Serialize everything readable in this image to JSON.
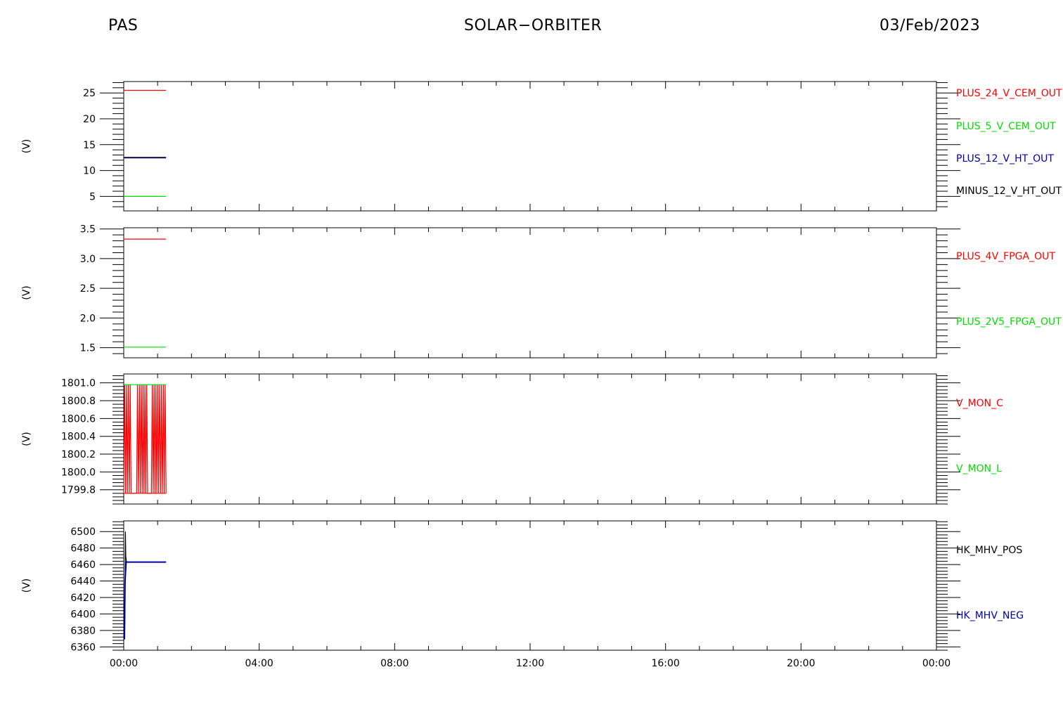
{
  "header": {
    "instrument": "PAS",
    "mission": "SOLAR−ORBITER",
    "date": "03/Feb/2023"
  },
  "time_axis": {
    "labels": [
      "00:00",
      "04:00",
      "08:00",
      "12:00",
      "16:00",
      "20:00",
      "00:00"
    ],
    "range_hours": [
      0,
      24
    ]
  },
  "chart_data": [
    {
      "type": "line",
      "ylabel": "(V)",
      "ylim": [
        2.2,
        27.2
      ],
      "yticks": [
        5,
        10,
        15,
        20,
        25
      ],
      "ytick_labels": [
        "5",
        "10",
        "15",
        "20",
        "25"
      ],
      "series": [
        {
          "name": "PLUS_24_V_CEM_OUT",
          "color": "#ff0000",
          "x": [
            0.0,
            1.25
          ],
          "y": [
            25.5,
            25.5
          ]
        },
        {
          "name": "PLUS_5_V_CEM_OUT",
          "color": "#00dd00",
          "x": [
            0.0,
            1.25
          ],
          "y": [
            5.0,
            5.0
          ]
        },
        {
          "name": "PLUS_12_V_HT_OUT",
          "color": "#0000aa",
          "x": [
            0.0,
            1.25
          ],
          "y": [
            12.5,
            12.5
          ]
        },
        {
          "name": "MINUS_12_V_HT_OUT",
          "color": "#000000",
          "x": [
            0.0,
            1.25
          ],
          "y": [
            12.5,
            12.5
          ]
        }
      ]
    },
    {
      "type": "line",
      "ylabel": "(V)",
      "ylim": [
        1.33,
        3.52
      ],
      "yticks": [
        1.5,
        2.0,
        2.5,
        3.0,
        3.5
      ],
      "ytick_labels": [
        "1.5",
        "2.0",
        "2.5",
        "3.0",
        "3.5"
      ],
      "series": [
        {
          "name": "PLUS_4V_FPGA_OUT",
          "color": "#ff0000",
          "x": [
            0.0,
            1.25
          ],
          "y": [
            3.33,
            3.33
          ]
        },
        {
          "name": "PLUS_2V5_FPGA_OUT",
          "color": "#00dd00",
          "x": [
            0.0,
            1.25
          ],
          "y": [
            1.51,
            1.51
          ]
        }
      ]
    },
    {
      "type": "line",
      "ylabel": "(V)",
      "ylim": [
        1799.64,
        1801.1
      ],
      "yticks": [
        1799.8,
        1800.0,
        1800.2,
        1800.4,
        1800.6,
        1800.8,
        1801.0
      ],
      "ytick_labels": [
        "1799.8",
        "1800.0",
        "1800.2",
        "1800.4",
        "1800.6",
        "1800.8",
        "1801.0"
      ],
      "series": [
        {
          "name": "V_MON_C",
          "color": "#ff0000",
          "pattern": "toggle",
          "x": [
            0.0,
            1.25
          ],
          "y": [
            1799.76,
            1800.98
          ]
        },
        {
          "name": "V_MON_L",
          "color": "#00dd00",
          "x": [
            0.0,
            1.25
          ],
          "y": [
            1800.98,
            1800.98
          ]
        }
      ]
    },
    {
      "type": "line",
      "ylabel": "(V)",
      "ylim": [
        6356,
        6513
      ],
      "yticks": [
        6360,
        6380,
        6400,
        6420,
        6440,
        6460,
        6480,
        6500
      ],
      "ytick_labels": [
        "6360",
        "6380",
        "6400",
        "6420",
        "6440",
        "6460",
        "6480",
        "6500"
      ],
      "series": [
        {
          "name": "HK_MHV_POS",
          "color": "#000000",
          "x": [
            0.0,
            0.03,
            0.05,
            0.06,
            0.08,
            1.25
          ],
          "y": [
            6380,
            6380,
            6500,
            6470,
            6463,
            6463
          ]
        },
        {
          "name": "HK_MHV_NEG",
          "color": "#0000aa",
          "x": [
            0.0,
            0.02,
            0.04,
            0.07,
            1.25
          ],
          "y": [
            6370,
            6370,
            6440,
            6463,
            6463
          ]
        }
      ]
    }
  ]
}
